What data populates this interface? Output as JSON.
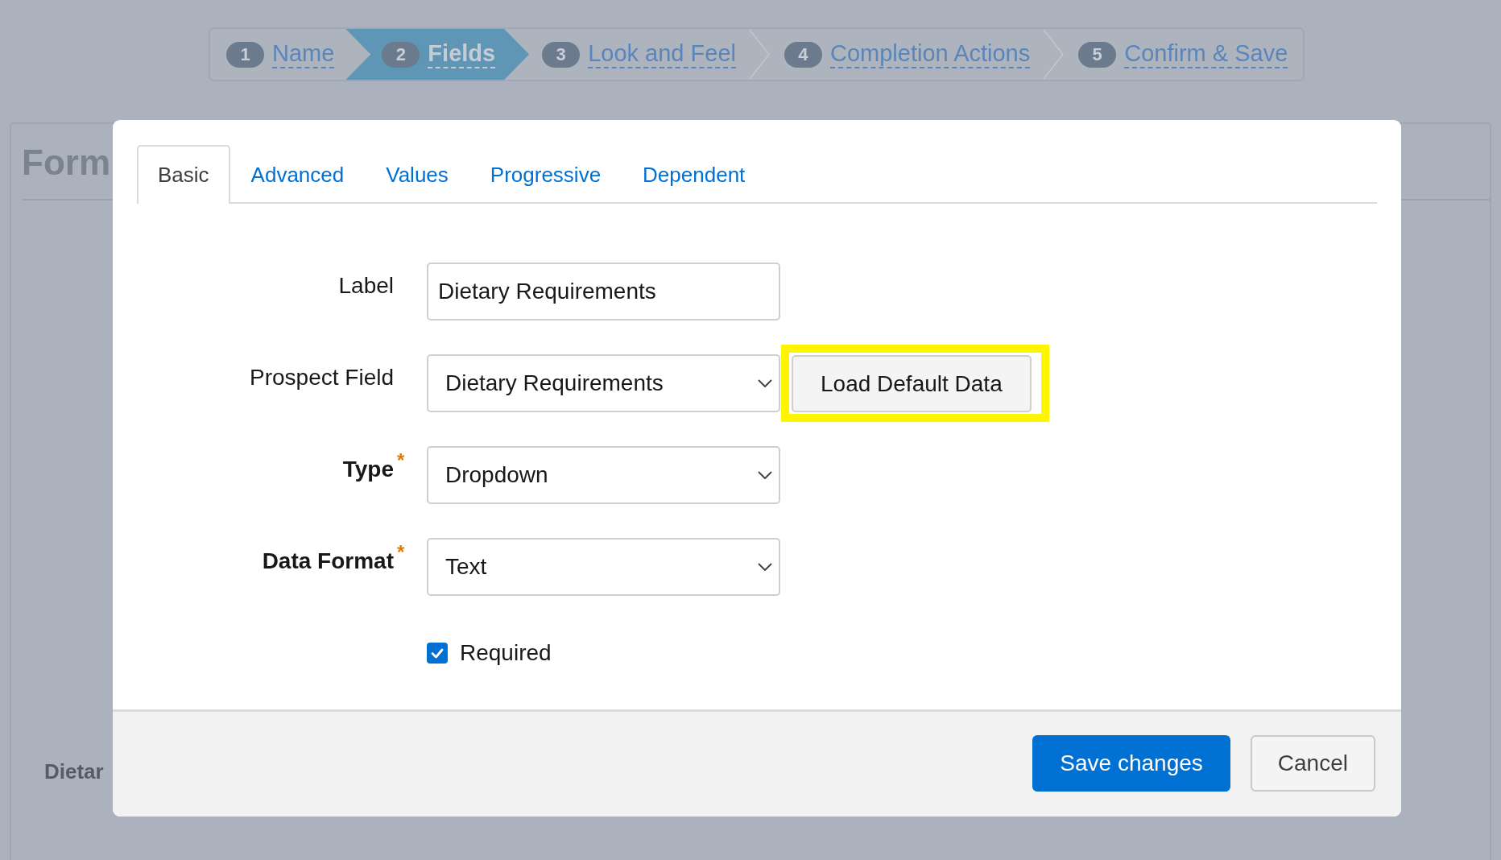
{
  "wizard": {
    "steps": [
      {
        "number": "1",
        "label": "Name",
        "selected": false
      },
      {
        "number": "2",
        "label": "Fields",
        "selected": true
      },
      {
        "number": "3",
        "label": "Look and Feel",
        "selected": false
      },
      {
        "number": "4",
        "label": "Completion Actions",
        "selected": false
      },
      {
        "number": "5",
        "label": "Confirm & Save",
        "selected": false
      }
    ]
  },
  "page": {
    "heading": "Form",
    "field_label": "Dietar"
  },
  "dialog": {
    "tabs": [
      {
        "label": "Basic",
        "selected": true
      },
      {
        "label": "Advanced",
        "selected": false
      },
      {
        "label": "Values",
        "selected": false
      },
      {
        "label": "Progressive",
        "selected": false
      },
      {
        "label": "Dependent",
        "selected": false
      }
    ],
    "fields": [
      {
        "kind": "text",
        "label": "Label",
        "required": false,
        "value": "Dietary Requirements"
      },
      {
        "kind": "select",
        "label": "Prospect Field",
        "required": false,
        "value": "Dietary Requirements",
        "action": {
          "label": "Load Default Data",
          "highlighted": true
        }
      },
      {
        "kind": "select",
        "label": "Type",
        "required": true,
        "required_mark": "*",
        "value": "Dropdown"
      },
      {
        "kind": "select",
        "label": "Data Format",
        "required": true,
        "required_mark": "*",
        "value": "Text"
      }
    ],
    "checkboxes": [
      {
        "label": "Required",
        "checked": true
      }
    ],
    "buttons": [
      {
        "label": "Save changes",
        "kind": "primary"
      },
      {
        "label": "Cancel",
        "kind": "secondary"
      }
    ]
  }
}
